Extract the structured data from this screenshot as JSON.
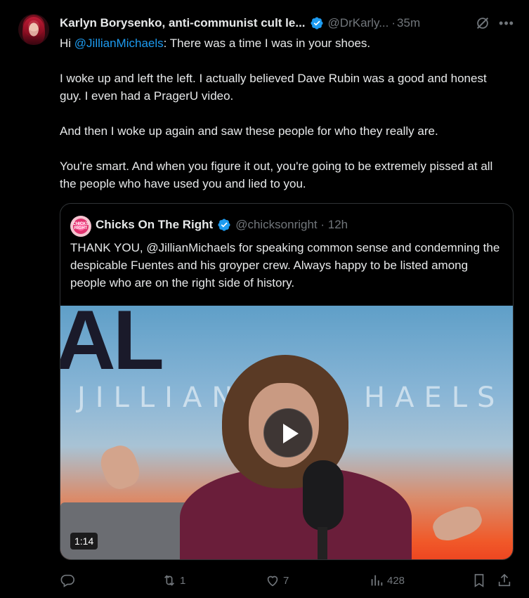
{
  "tweet": {
    "author_name": "Karlyn Borysenko, anti-communist cult le...",
    "handle": "@DrKarly...",
    "separator": "·",
    "time": "35m",
    "body": {
      "p1_prefix": "Hi ",
      "p1_mention": "@JillianMichaels",
      "p1_suffix": ":  There was a time I was in your shoes.",
      "p2": "I woke up and left the left. I actually believed Dave Rubin was a good and honest guy. I even had a PragerU video.",
      "p3": "And then I woke up again and saw these people for who they really are.",
      "p4": "You're smart. And when you figure it out, you're going to be extremely pissed at all the people who have used you and lied to you."
    },
    "icons": {
      "verified": "verified-badge-icon",
      "grok": "grok-icon",
      "more": "more-icon"
    },
    "accent_color": "#1d9bf0"
  },
  "quote": {
    "avatar_text": "CHICKS RIGHT",
    "name": "Chicks On The Right",
    "handle": "@chicksonright · 12h",
    "text": "THANK YOU, @JillianMichaels for speaking common sense and condemning the despicable Fuentes and his groyper crew.  Always happy to be listed among people who are on the right side of history.",
    "video": {
      "bg_text_1": "AL",
      "bg_text_2": "JILLIAN",
      "bg_text_3": "HAELS",
      "duration": "1:14"
    }
  },
  "actions": {
    "reply_count": "",
    "retweet_count": "1",
    "like_count": "7",
    "views_count": "428"
  }
}
